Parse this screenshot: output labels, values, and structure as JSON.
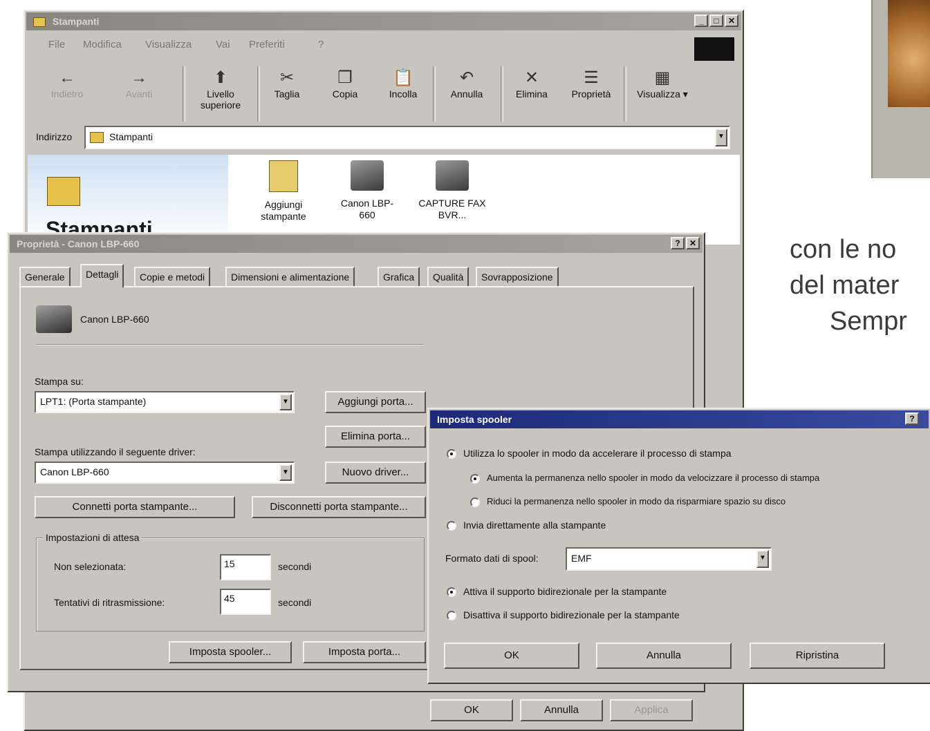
{
  "explorer": {
    "title": "Stampanti",
    "menu": [
      "File",
      "Modifica",
      "Visualizza",
      "Vai",
      "Preferiti",
      "?"
    ],
    "toolbar": [
      {
        "label": "Indietro",
        "icon": "←"
      },
      {
        "label": "Avanti",
        "icon": "→"
      },
      {
        "label": "Livello superiore",
        "icon": "⬆"
      },
      {
        "label": "Taglia",
        "icon": "✂"
      },
      {
        "label": "Copia",
        "icon": "❐"
      },
      {
        "label": "Incolla",
        "icon": "📋"
      },
      {
        "label": "Annulla",
        "icon": "↶"
      },
      {
        "label": "Elimina",
        "icon": "✕"
      },
      {
        "label": "Proprietà",
        "icon": "☰"
      },
      {
        "label": "Visualizza",
        "icon": "▦"
      }
    ],
    "address_label": "Indirizzo",
    "address_value": "Stampanti",
    "folder_heading": "Stampanti",
    "icons": [
      {
        "label": "Aggiungi stampante"
      },
      {
        "label": "Canon LBP-660"
      },
      {
        "label": "CAPTURE FAX BVR..."
      }
    ]
  },
  "properties": {
    "title": "Proprietà - Canon LBP-660",
    "tabs": [
      "Generale",
      "Dettagli",
      "Copie e metodi",
      "Dimensioni e alimentazione",
      "Grafica",
      "Qualità",
      "Sovrapposizione"
    ],
    "selected_tab": "Dettagli",
    "printer_name": "Canon LBP-660",
    "print_to_label": "Stampa su:",
    "print_to_value": "LPT1:  (Porta stampante)",
    "driver_label": "Stampa utilizzando il seguente driver:",
    "driver_value": "Canon LBP-660",
    "add_port": "Aggiungi porta...",
    "delete_port": "Elimina porta...",
    "new_driver": "Nuovo driver...",
    "connect_port": "Connetti porta stampante...",
    "disconnect_port": "Disconnetti porta stampante...",
    "timeouts_label": "Impostazioni di attesa",
    "not_selected_label": "Non selezionata:",
    "not_selected_value": "15",
    "retry_label": "Tentativi di ritrasmissione:",
    "retry_value": "45",
    "seconds": "secondi",
    "spool_settings": "Imposta spooler...",
    "port_settings": "Imposta porta...",
    "ok": "OK",
    "cancel": "Annulla",
    "apply": "Applica"
  },
  "spooler": {
    "title": "Imposta spooler",
    "opt_spool": "Utilizza lo spooler in modo da accelerare il processo di stampa",
    "opt_faster": "Aumenta la permanenza nello spooler in modo da velocizzare il processo di stampa",
    "opt_less_disk": "Riduci la permanenza nello spooler in modo da risparmiare spazio su disco",
    "opt_direct": "Invia direttamente alla stampante",
    "format_label": "Formato dati di spool:",
    "format_value": "EMF",
    "bidi_on": "Attiva il supporto bidirezionale per la stampante",
    "bidi_off": "Disattiva il supporto bidirezionale per la stampante",
    "ok": "OK",
    "cancel": "Annulla",
    "restore": "Ripristina"
  },
  "page_text": {
    "line1": "con le no",
    "line2": "del mater",
    "line3": "Sempr"
  }
}
